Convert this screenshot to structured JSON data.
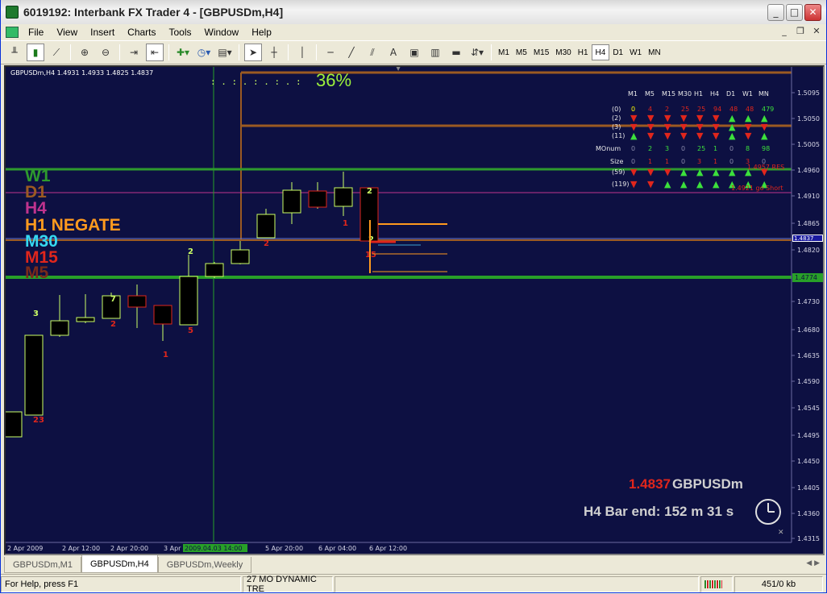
{
  "window": {
    "title": "6019192: Interbank FX Trader 4 - [GBPUSDm,H4]"
  },
  "menu": [
    "File",
    "View",
    "Insert",
    "Charts",
    "Tools",
    "Window",
    "Help"
  ],
  "toolbar": {
    "timeframes": [
      "M1",
      "M5",
      "M15",
      "M30",
      "H1",
      "H4",
      "D1",
      "W1",
      "MN"
    ],
    "active_timeframe": "H4",
    "text_tool": "A"
  },
  "chart": {
    "header": "GBPUSDm,H4 1.4931 1.4933 1.4825 1.4837",
    "progress": "36%",
    "progress_dots": ":  .  :  .  :  .  :  .  :",
    "price_axis": [
      "1.5095",
      "1.5050",
      "1.5005",
      "1.4960",
      "1.4910",
      "1.4865",
      "1.4820",
      "1.4730",
      "1.4680",
      "1.4635",
      "1.4590",
      "1.4545",
      "1.4495",
      "1.4450",
      "1.4405",
      "1.4360",
      "1.4315"
    ],
    "time_axis": [
      "2 Apr 2009",
      "2 Apr 12:00",
      "2 Apr 20:00",
      "3 Apr",
      "3 Apr 14:00",
      "5 Apr 20:00",
      "6 Apr 04:00",
      "6 Apr 12:00"
    ],
    "time_axis_highlight": "2009.04.03 14:00",
    "current_price_tag": "1.4837",
    "green_level_tag": "1.4774",
    "levels": [
      {
        "label": "W1",
        "color": "#2e9a2e"
      },
      {
        "label": "D1",
        "color": "#9b5a22"
      },
      {
        "label": "H4",
        "color": "#c0338e"
      },
      {
        "label": "H1 NEGATE",
        "color": "#ff9a1e"
      },
      {
        "label": "M30",
        "color": "#35d8f0"
      },
      {
        "label": "M15",
        "color": "#e0261c"
      },
      {
        "label": "M5",
        "color": "#7a2a1a"
      }
    ],
    "candle_numbers": [
      "3",
      "23",
      "7",
      "2",
      "1",
      "2",
      "5",
      "2",
      "2",
      "1",
      "2",
      "15"
    ],
    "res_label": "1.4957 RES",
    "short_label": "1.4921 go Short",
    "price_big": "1.4837",
    "symbol_big": "GBPUSDm",
    "bar_end": "H4 Bar end: 152 m 31 s",
    "matrix": {
      "header": [
        "M1",
        "M5",
        "M15",
        "M30",
        "H1",
        "H4",
        "D1",
        "W1",
        "MN"
      ],
      "ma_row": [
        "0",
        "4",
        "2",
        "25",
        "25",
        "94",
        "48",
        "48",
        "479"
      ],
      "row_labels": [
        "(0)",
        "(2)",
        "(3)",
        "(11)",
        "MOnum",
        "Size",
        "(59)",
        "(119)"
      ],
      "monum": [
        "0",
        "2",
        "3",
        "0",
        "25",
        "1",
        "0",
        "8",
        "98"
      ],
      "size": [
        "0",
        "1",
        "1",
        "0",
        "3",
        "1",
        "0",
        "3",
        "0"
      ]
    }
  },
  "tabs": [
    "GBPUSDm,M1",
    "GBPUSDm,H4",
    "GBPUSDm,Weekly"
  ],
  "active_tab": "GBPUSDm,H4",
  "status": {
    "help": "For Help, press F1",
    "profile": "27 MO DYNAMIC TRE",
    "traffic": "451/0 kb"
  },
  "colors": {
    "chart_bg": "#0d1042",
    "bull": "#ccff66",
    "bear_fill": "#000000",
    "wick": "#ccff66",
    "grid_green": "#28a028",
    "price_line": "#ff9a1e"
  }
}
